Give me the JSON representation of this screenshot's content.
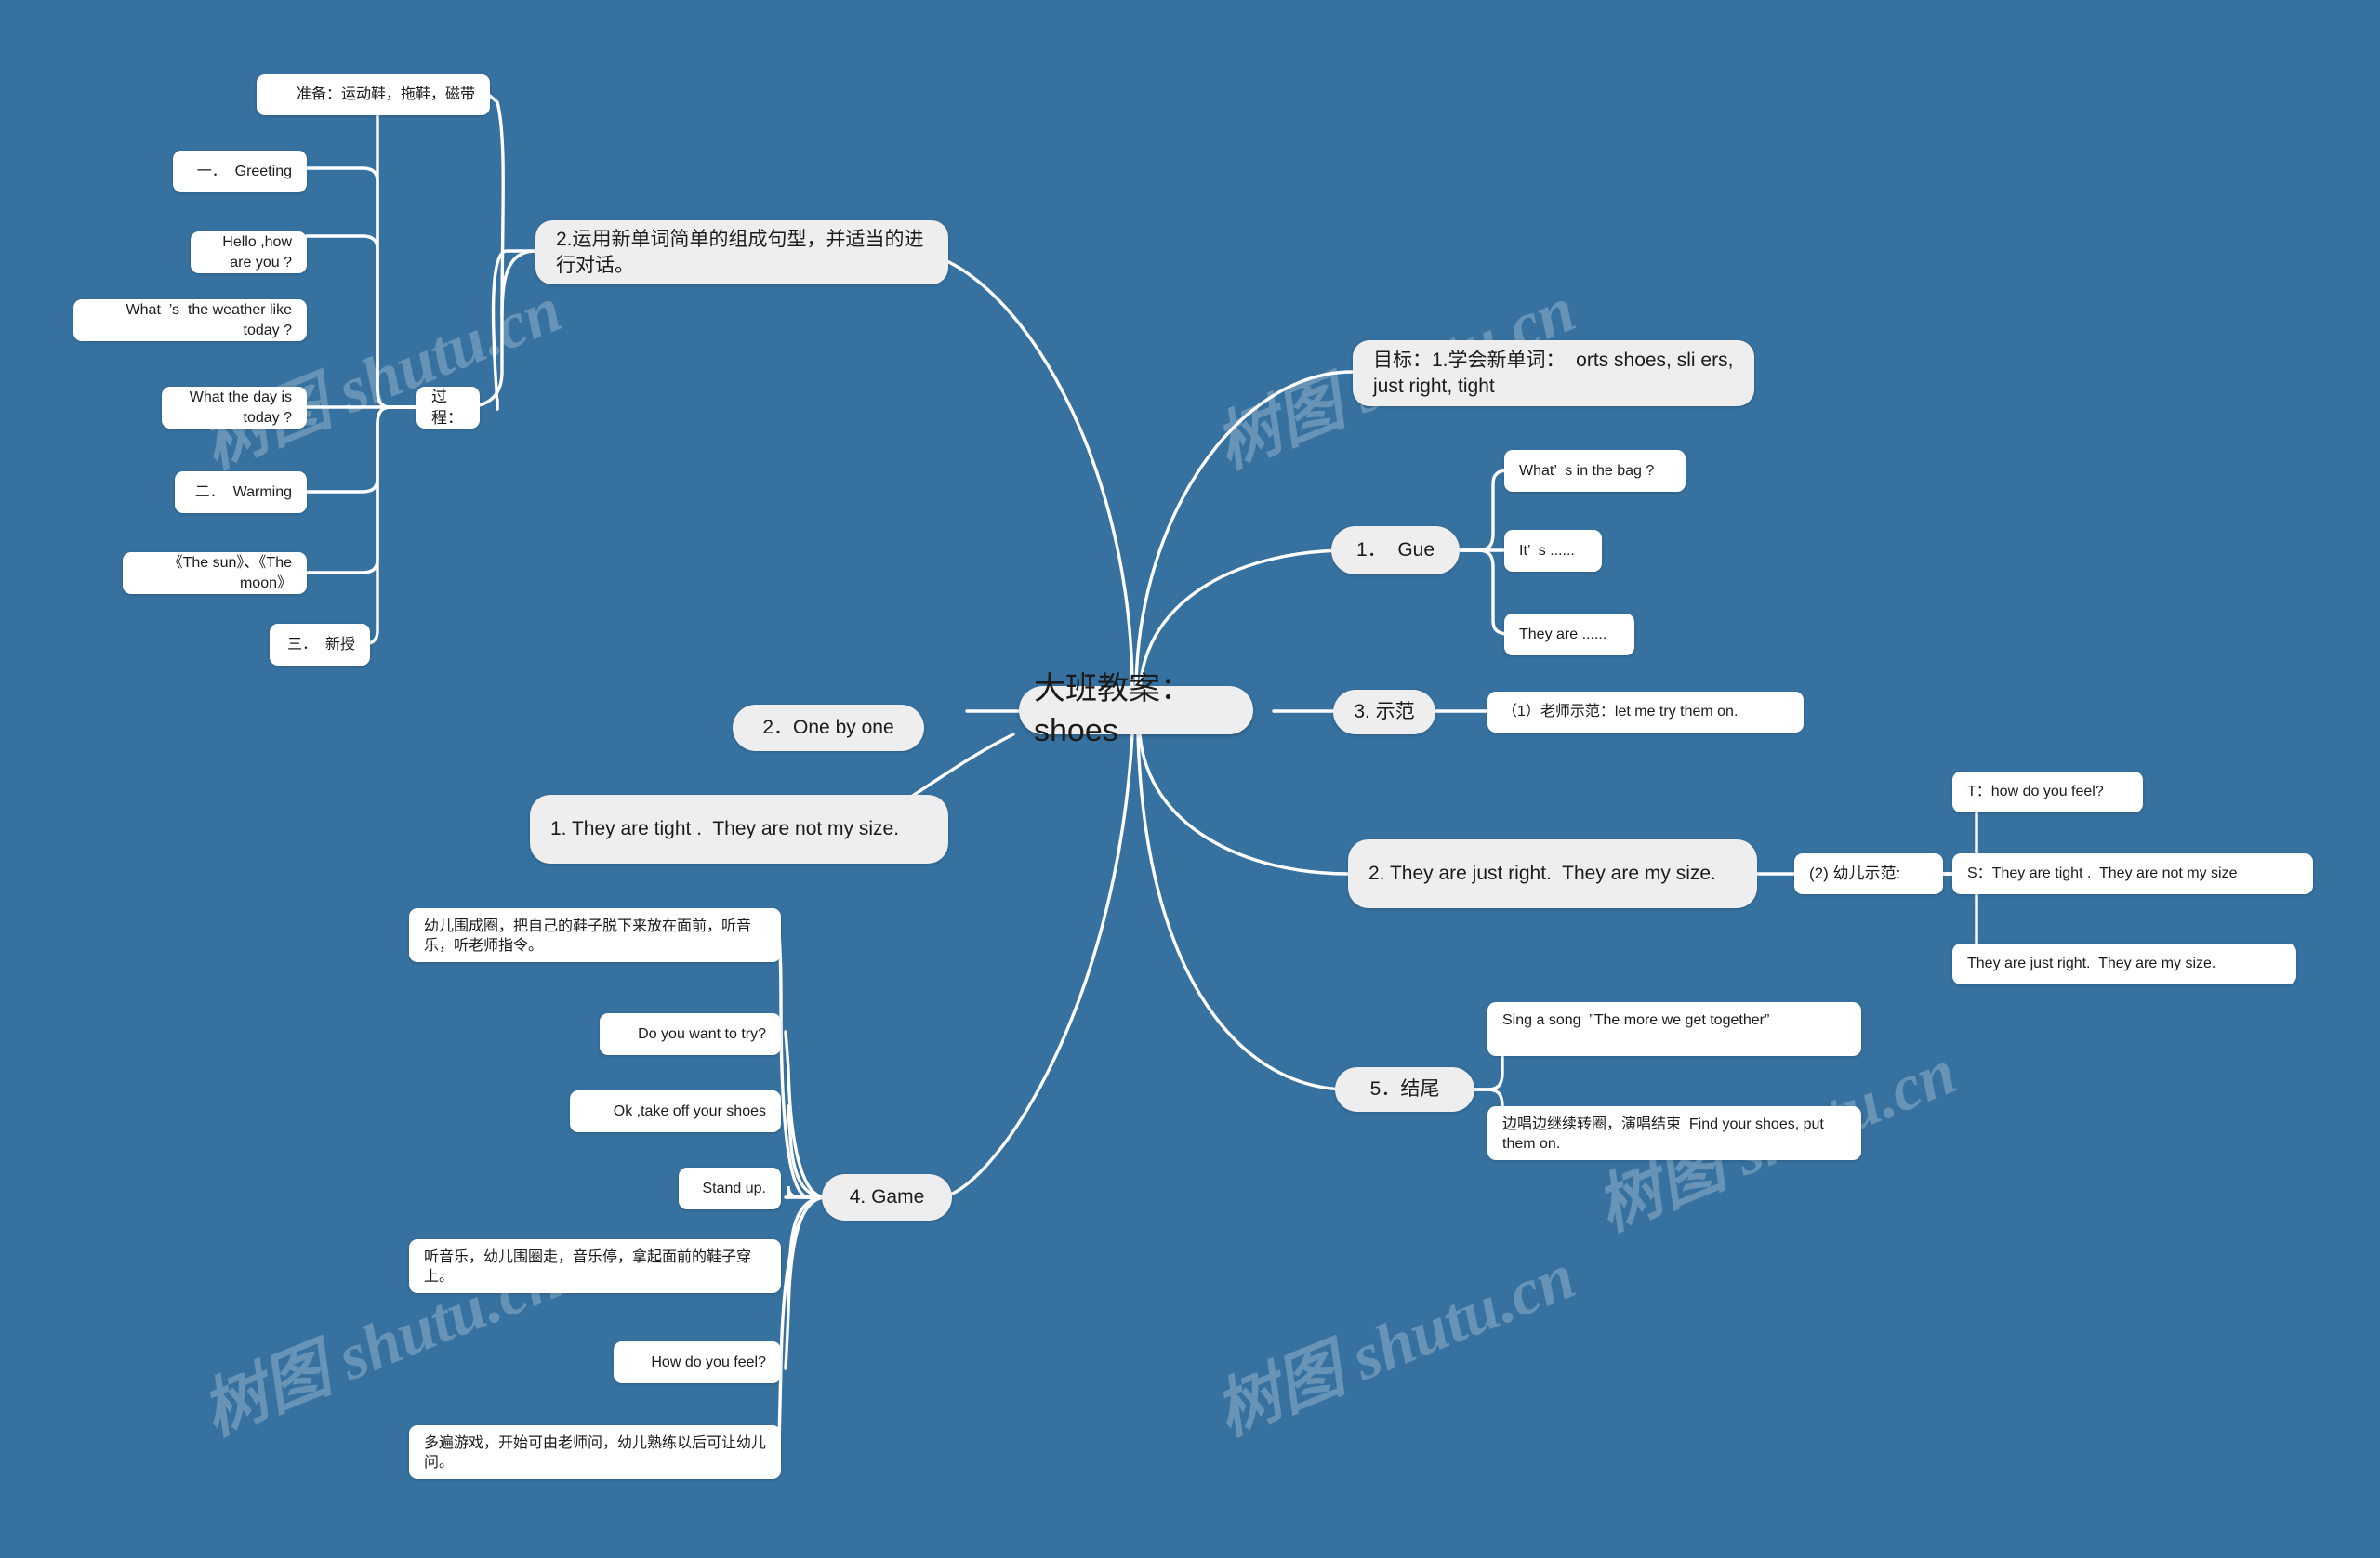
{
  "theme": {
    "background": "#36719f",
    "node_fill": "#ffffff",
    "branch_fill": "#eeeeee",
    "edge_color": "#ffffff",
    "text_color": "#1b1b1b"
  },
  "watermark": {
    "text": "树图 shutu.cn"
  },
  "root": {
    "label": "大班教案：shoes"
  },
  "nodes": {
    "prep": "准备：运动鞋，拖鞋，磁带",
    "greeting": "一．  Greeting",
    "hello": "Hello ,how are you ?",
    "weather": "What  ’s  the weather like today ?",
    "day": "What the day is today ?",
    "warming": "二．  Warming",
    "songs": "《The sun》、《The moon》",
    "newteach": "三．  新授",
    "process": "过程：",
    "goal2": "2.运用新单词简单的组成句型，并适当的进行对话。",
    "goal1": "目标：1.学会新单词：  orts shoes, sli ers, just right, tight",
    "guess": "1．  Gue",
    "guess_a": "What’  s in the bag ?",
    "guess_b": "It’  s ......",
    "guess_c": "They are ......",
    "demo": "3. 示范",
    "demo_teacher": "（1）老师示范：let me try them on.",
    "right_sentence": "2. They are just right.  They are my size.",
    "demo_child": "(2) 幼儿示范:",
    "demo_child_a": "T：how do you feel?",
    "demo_child_b": "S：They are tight .  They are not my size",
    "demo_child_c": "They are just right.  They are my size.",
    "ending": "5．结尾",
    "ending_a": "Sing a song  ”The more we get together”",
    "ending_b": "边唱边继续转圈，演唱结束  Find your shoes, put them on.",
    "one_by_one": "2．One by one",
    "tight_sentence": "1. They are tight .  They are not my size.",
    "game": "4. Game",
    "game_a": "幼儿围成圈，把自己的鞋子脱下来放在面前，听音乐，听老师指令。",
    "game_b": "Do you want to try?",
    "game_c": "Ok ,take off your shoes",
    "game_d": "Stand up.",
    "game_e": "听音乐，幼儿围圈走，音乐停，拿起面前的鞋子穿上。",
    "game_f": "How do you feel?",
    "game_g": "多遍游戏，开始可由老师问，幼儿熟练以后可让幼儿问。"
  }
}
